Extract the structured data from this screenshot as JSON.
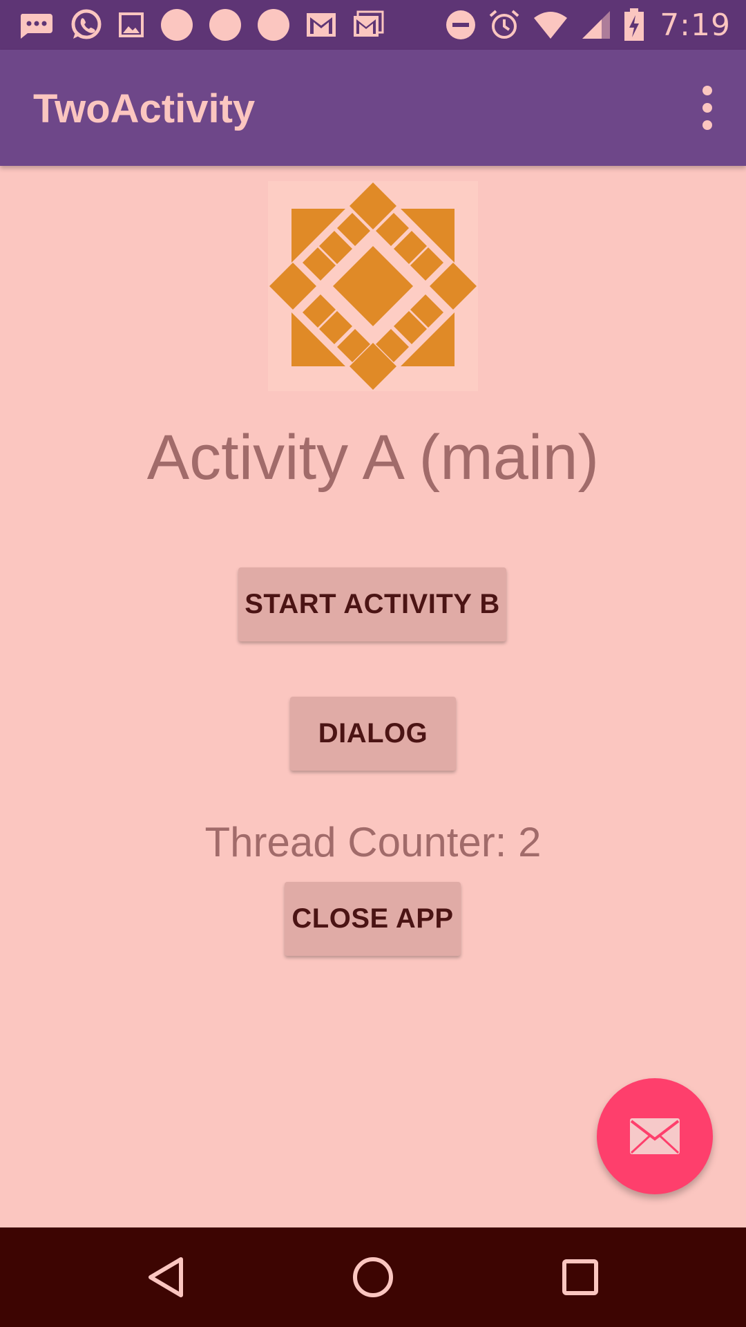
{
  "status_bar": {
    "time": "7:19",
    "left_icons": [
      "messages-icon",
      "whatsapp-icon",
      "gallery-icon",
      "notification-dot-icon",
      "notification-dot-icon",
      "notification-dot-icon",
      "gmail-icon",
      "gmail-stack-icon"
    ],
    "right_icons": [
      "do-not-disturb-icon",
      "alarm-icon",
      "wifi-icon",
      "cell-signal-icon",
      "battery-charging-icon"
    ]
  },
  "app_bar": {
    "title": "TwoActivity",
    "overflow_icon": "more-vert-icon"
  },
  "main": {
    "logo_icon": "geometric-logo",
    "activity_title": "Activity A (main)",
    "start_activity_b_label": "START ACTIVITY B",
    "dialog_label": "DIALOG",
    "thread_counter": "Thread Counter: 2",
    "close_app_label": "CLOSE APP"
  },
  "fab": {
    "icon": "mail-icon"
  },
  "nav_bar": {
    "icons": [
      "back-icon",
      "home-icon",
      "recents-icon"
    ]
  },
  "colors": {
    "status_bar": "#5e3575",
    "app_bar": "#6e4789",
    "background": "#fbc6c0",
    "button": "#e0aba6",
    "button_text": "#4b1414",
    "fab": "#fe3f6c",
    "logo": "#e08a27",
    "nav_bar": "#3d0502"
  }
}
